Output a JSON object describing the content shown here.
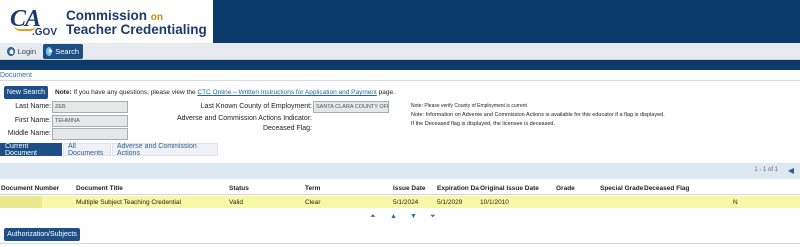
{
  "header": {
    "logo_ca": "CA",
    "logo_gov": ".GOV",
    "title_line1": "Commission",
    "title_on": "on",
    "title_line2": "Teacher Credentialing"
  },
  "nav": {
    "login_label": "Login",
    "search_label": "Search"
  },
  "section_label": "Document",
  "new_search_label": "New Search",
  "note": {
    "label": "Note:",
    "text_before": "If you have any questions, please view the",
    "link": "CTC Online – Written Instructions for Application and Payment",
    "text_after": "page."
  },
  "person": {
    "last_name_label": "Last Name:",
    "last_name": "ZEB",
    "first_name_label": "First Name:",
    "first_name": "TEHMINA",
    "middle_name_label": "Middle Name:",
    "middle_name": ""
  },
  "details": {
    "county_label": "Last Known County of Employment:",
    "county": "SANTA CLARA COUNTY OFF",
    "adverse_label": "Adverse and Commission Actions Indicator:",
    "deceased_label": "Deceased Flag:",
    "county_note": "Note: Please verify County of Employment is current",
    "info_note": "Note: Information on Adverse and Commission Actions is available for this educator if a flag is displayed.",
    "deceased_note": "If the Deceased flag is displayed, the licensee is deceased."
  },
  "tabs": [
    "Current Document",
    "All Documents",
    "Adverse and Commission Actions"
  ],
  "pager": {
    "text": "1 - 1 of 1",
    "arrow": "◀"
  },
  "table": {
    "columns": [
      "Document Number",
      "Document Title",
      "Status",
      "Term",
      "Issue Date",
      "Expiration Date",
      "Original Issue Date",
      "Grade",
      "Special Grade",
      "Deceased Flag"
    ],
    "rows": [
      {
        "document_number": "",
        "document_title": "Multiple Subject Teaching Credential",
        "status": "Valid",
        "term": "Clear",
        "issue_date": "5/1/2024",
        "expiration_date": "5/1/2029",
        "original_issue_date": "10/1/2010",
        "grade": "",
        "special_grade": "",
        "deceased_flag": "N"
      }
    ]
  },
  "sort_icons": [
    "first-icon",
    "up-icon",
    "down-icon",
    "last-icon"
  ],
  "authorization_button": "Authorization/Subjects",
  "colors": {
    "brand_navy": "#0b3a6b",
    "button_blue": "#1d4f86",
    "row_highlight": "#f8f7a6",
    "accent_gold": "#d08a10"
  }
}
